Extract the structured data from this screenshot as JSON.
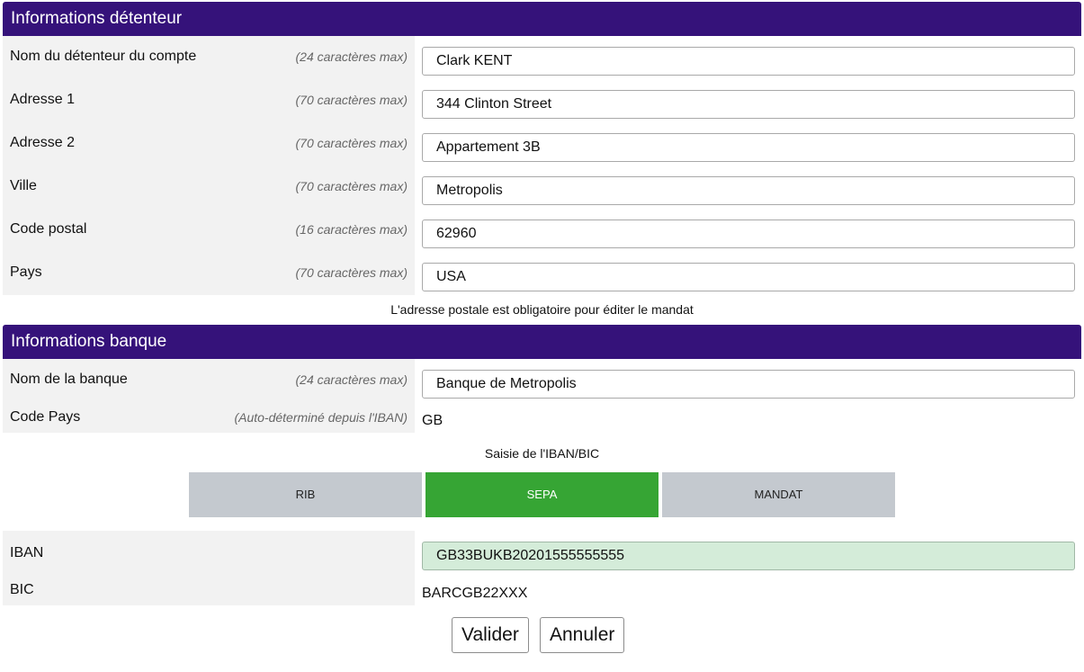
{
  "holder": {
    "title": "Informations détenteur",
    "fields": [
      {
        "label": "Nom du détenteur du compte",
        "hint": "(24 caractères max)",
        "value": "Clark KENT"
      },
      {
        "label": "Adresse 1",
        "hint": "(70 caractères max)",
        "value": "344 Clinton Street"
      },
      {
        "label": "Adresse 2",
        "hint": "(70 caractères max)",
        "value": "Appartement 3B"
      },
      {
        "label": "Ville",
        "hint": "(70 caractères max)",
        "value": "Metropolis"
      },
      {
        "label": "Code postal",
        "hint": "(16 caractères max)",
        "value": "62960"
      },
      {
        "label": "Pays",
        "hint": "(70 caractères max)",
        "value": "USA"
      }
    ],
    "note": "L'adresse postale est obligatoire pour éditer le mandat"
  },
  "bank": {
    "title": "Informations banque",
    "bank_name": {
      "label": "Nom de la banque",
      "hint": "(24 caractères max)",
      "value": "Banque de Metropolis"
    },
    "country_code": {
      "label": "Code Pays",
      "hint": "(Auto-déterminé depuis l'IBAN)",
      "value": "GB"
    },
    "iban_bic_caption": "Saisie de l'IBAN/BIC",
    "tabs": [
      {
        "label": "RIB",
        "active": false
      },
      {
        "label": "SEPA",
        "active": true
      },
      {
        "label": "MANDAT",
        "active": false
      }
    ],
    "iban": {
      "label": "IBAN",
      "value": "GB33BUKB20201555555555"
    },
    "bic": {
      "label": "BIC",
      "value": "BARCGB22XXX"
    }
  },
  "actions": {
    "validate_label": "Valider",
    "cancel_label": "Annuler"
  },
  "colors": {
    "header": "#35127a",
    "active_tab": "#36a534",
    "inactive_tab": "#c4c9cf",
    "iban_valid_bg": "#d4ecd9"
  }
}
